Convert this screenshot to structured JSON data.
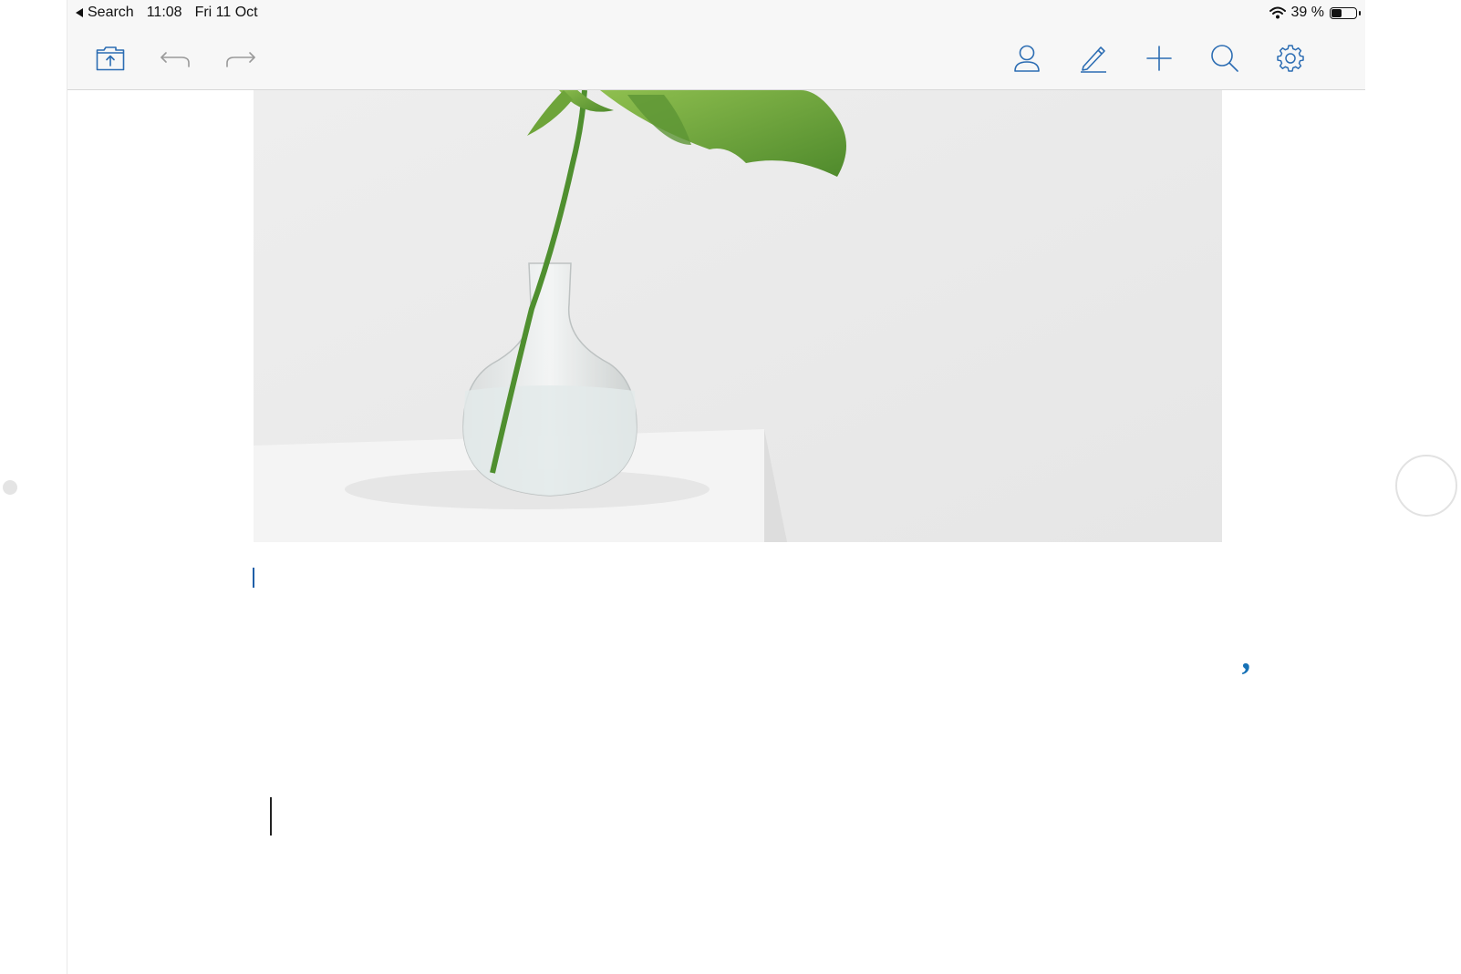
{
  "status_bar": {
    "back_label": "Search",
    "time": "11:08",
    "date": "Fri 11 Oct",
    "battery_text": "39 %",
    "battery_level": 0.39
  },
  "toolbar": {
    "file_name": "",
    "icons": [
      "files-upload-icon",
      "undo-icon",
      "redo-icon",
      "user-icon",
      "pencil-icon",
      "plus-icon",
      "search-icon",
      "settings-gear-icon"
    ]
  },
  "document": {
    "image_alt": "",
    "heading": "",
    "paragraph_segments": {
      "formatted_text": "",
      "sep1": "",
      "paragraphs": "",
      "images": "",
      "tables_and": "",
      "charts": "",
      "shapes": "",
      "sep2": "",
      "headings": "",
      "and": "",
      "footers": "",
      "footers_2": "",
      "bullets_before_cursor": "",
      "bullets_after_cursor": "",
      "last_line": ""
    }
  },
  "colors": {
    "heading_blue": "#1e73c1",
    "formatted_cyan": "#12a8e0",
    "images_green": "#16862f",
    "charts_orange": "#f46d12",
    "highlight_yellow": "#ffff00",
    "toolbar_icon_blue": "#2c6db3"
  }
}
